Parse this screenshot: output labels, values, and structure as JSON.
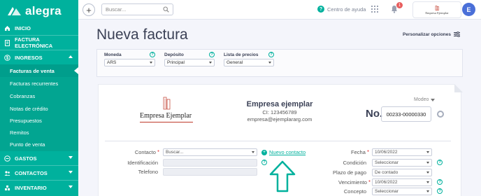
{
  "brand": {
    "name": "alegra",
    "accent": "#00b19d"
  },
  "sidebar": {
    "top_items": [
      {
        "label": "INICIO",
        "icon": "home-icon"
      },
      {
        "label": "FACTURA ELECTRÓNICA",
        "icon": "file-icon"
      },
      {
        "label": "INGRESOS",
        "icon": "income-icon"
      }
    ],
    "sub_items": [
      {
        "label": "Facturas de venta",
        "active": true
      },
      {
        "label": "Facturas recurrentes"
      },
      {
        "label": "Cobranzas"
      },
      {
        "label": "Notas de crédito"
      },
      {
        "label": "Presupuestos"
      },
      {
        "label": "Remitos"
      },
      {
        "label": "Punto de venta"
      }
    ],
    "bottom_items": [
      {
        "label": "GASTOS",
        "icon": "expense-icon"
      },
      {
        "label": "CONTACTOS",
        "icon": "contacts-icon"
      },
      {
        "label": "INVENTARIO",
        "icon": "inventory-icon"
      }
    ]
  },
  "topbar": {
    "search_placeholder": "Buscar...",
    "help_label": "Centro de ayuda",
    "notifications_count": "1",
    "company_chip": "Empresa Ejemplar",
    "avatar_initial": "E"
  },
  "page": {
    "title": "Nueva factura",
    "personalize": "Personalizar opciones"
  },
  "filters": {
    "moneda": {
      "label": "Moneda",
      "value": "ARS"
    },
    "deposito": {
      "label": "Depósito",
      "value": "Principal"
    },
    "lista": {
      "label": "Lista de precios",
      "value": "General"
    }
  },
  "invoice": {
    "logo_text": "Empresa Ejemplar",
    "company_name": "Empresa ejemplar",
    "company_ci": "CI: 123456789",
    "company_email": "empresa@ejemplararg.com",
    "modelo": "Modeo",
    "number_label": "No.",
    "number_value": "00233-00000330"
  },
  "form": {
    "contacto": {
      "label": "Contacto",
      "placeholder": "Buscar..."
    },
    "identificacion": {
      "label": "Identificación"
    },
    "telefono": {
      "label": "Telefono"
    },
    "new_contact": "Nuevo contacto",
    "fecha": {
      "label": "Fecha",
      "value": "10/06/2022"
    },
    "condicion": {
      "label": "Condición",
      "value": "Seleccionar"
    },
    "plazo": {
      "label": "Plazo de pago",
      "value": "De contado"
    },
    "vencimiento": {
      "label": "Vencimiento",
      "value": "10/06/2022"
    },
    "concepto": {
      "label": "Concepto",
      "value": "Seleccionar"
    }
  }
}
